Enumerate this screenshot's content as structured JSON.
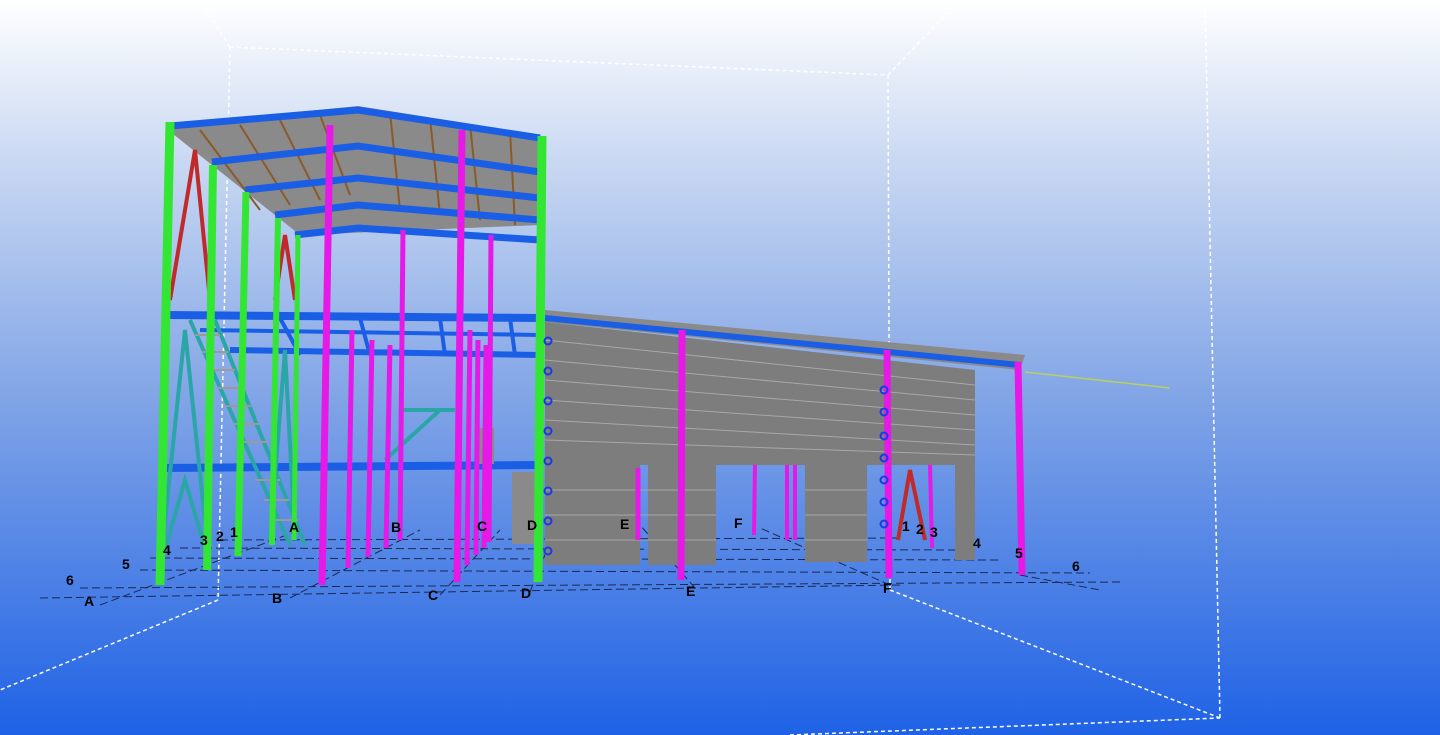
{
  "view": {
    "type": "3d-steel-structure-model",
    "background_top": "#ffffff",
    "background_bottom": "#1f62e6"
  },
  "colors": {
    "column_green": "#33e633",
    "column_magenta": "#e619e6",
    "beam_blue": "#1a5ee6",
    "brace_red": "#c02a2a",
    "brace_teal": "#2aa6a6",
    "roof_gray": "#8a8a8a",
    "wall_gray": "#7d7d7d",
    "work_area": "#ffffff"
  },
  "grid_labels": {
    "left_A": "A",
    "left_B": "B",
    "left_C": "C",
    "left_D": "D",
    "left_1": "1",
    "left_2": "2",
    "left_3": "3",
    "left_4": "4",
    "left_5": "5",
    "left_6": "6",
    "right_E": "E",
    "right_F": "F",
    "right_1": "1",
    "right_2": "2",
    "right_3": "3",
    "right_4": "4",
    "right_5": "5",
    "right_6": "6",
    "back_B": "B",
    "back_C": "C",
    "back_D": "D",
    "back_E": "E",
    "back_F": "F",
    "back_A": "A"
  }
}
